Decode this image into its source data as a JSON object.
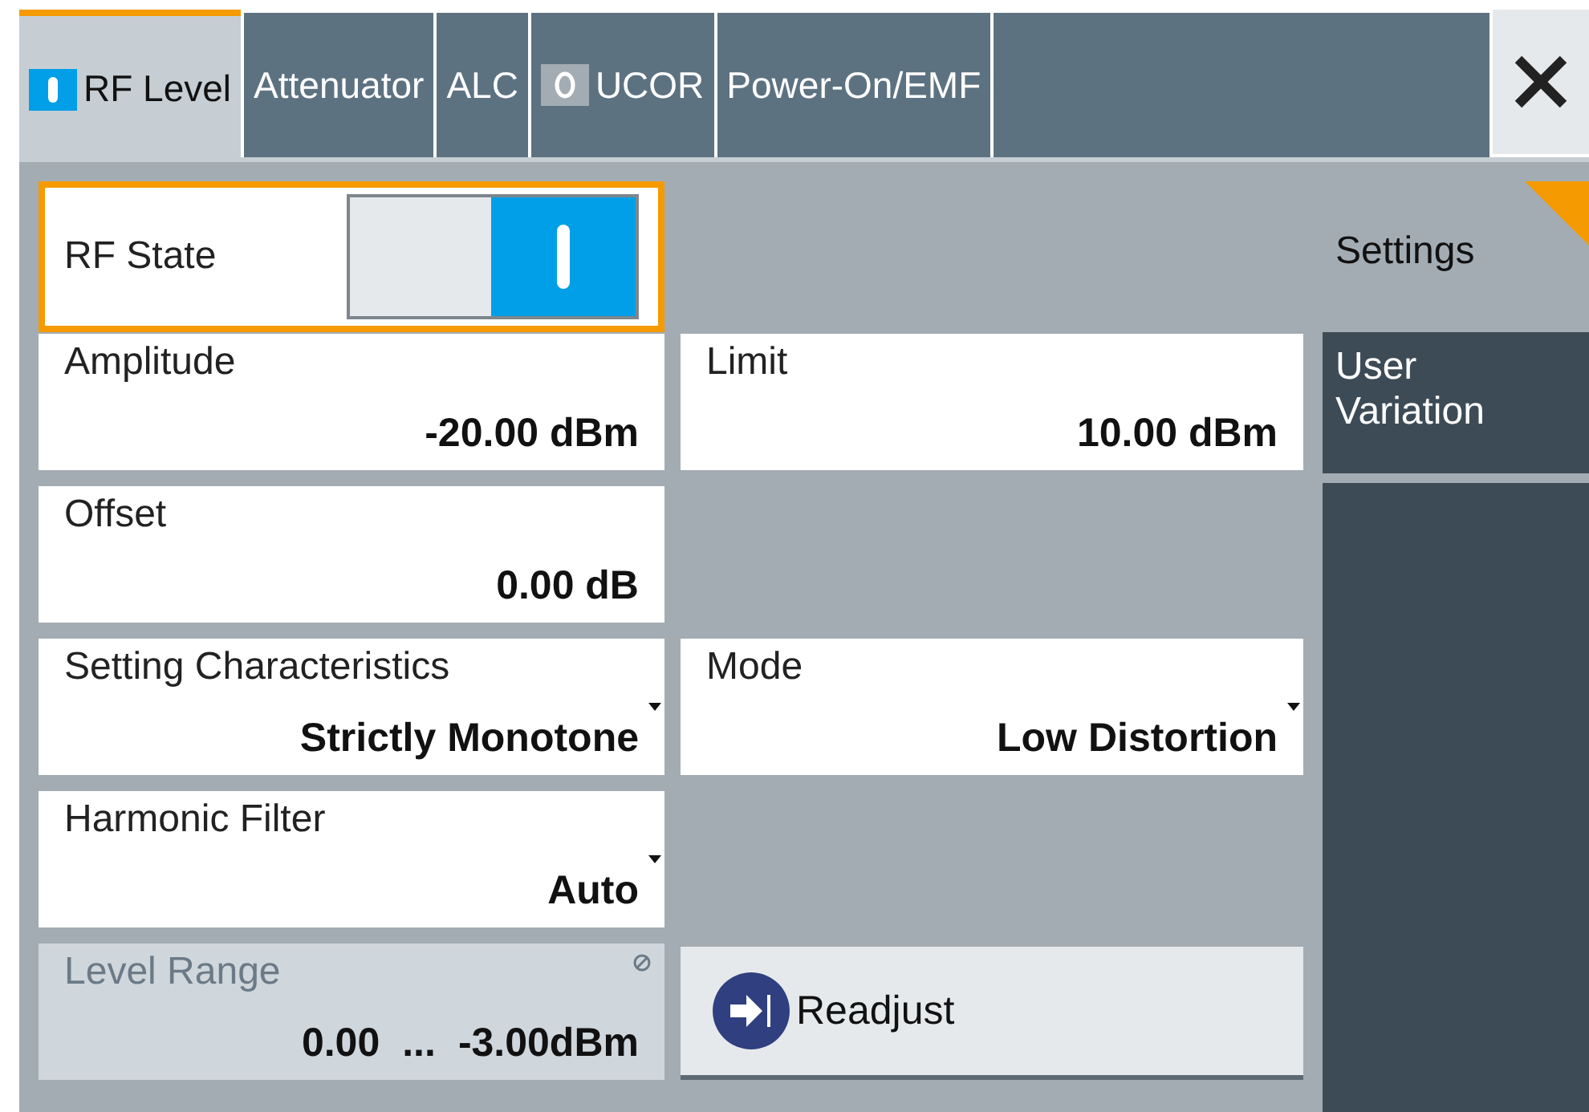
{
  "tabs": [
    {
      "label": "RF Level",
      "selected": true,
      "on": true
    },
    {
      "label": "Attenuator",
      "selected": false
    },
    {
      "label": "ALC",
      "selected": false
    },
    {
      "label": "UCOR",
      "selected": false,
      "on": false
    },
    {
      "label": "Power-On/EMF",
      "selected": false
    }
  ],
  "rows": [
    {
      "cells": [
        {
          "kind": "toggle",
          "label": "RF State",
          "on": true,
          "disabled": false
        }
      ]
    },
    {
      "cells": [
        {
          "kind": "value",
          "label": "Amplitude",
          "value": "-20.00 dBm",
          "disabled": false
        },
        {
          "kind": "value",
          "label": "Limit",
          "value": "10.00 dBm",
          "disabled": false
        }
      ]
    },
    {
      "cells": [
        {
          "kind": "value",
          "label": "Offset",
          "value": "0.00 dB",
          "disabled": false
        }
      ]
    },
    {
      "cells": [
        {
          "kind": "dropdown",
          "label": "Setting Characteristics",
          "value": "Strictly Monotone",
          "disabled": false
        },
        {
          "kind": "dropdown",
          "label": "Mode",
          "value": "Low Distortion",
          "disabled": false
        }
      ]
    },
    {
      "cells": [
        {
          "kind": "dropdown",
          "label": "Harmonic Filter",
          "value": "Auto",
          "disabled": false
        }
      ]
    },
    {
      "cells": [
        {
          "kind": "range",
          "label": "Level Range",
          "from": "0.00",
          "dots": "...",
          "to": "-3.00dBm",
          "disabled": true
        },
        {
          "kind": "button",
          "label": "Readjust",
          "disabled": false
        }
      ]
    }
  ],
  "side_tabs": [
    {
      "label": "Settings",
      "selected": true
    },
    {
      "label": "User Variation",
      "selected": false
    }
  ]
}
